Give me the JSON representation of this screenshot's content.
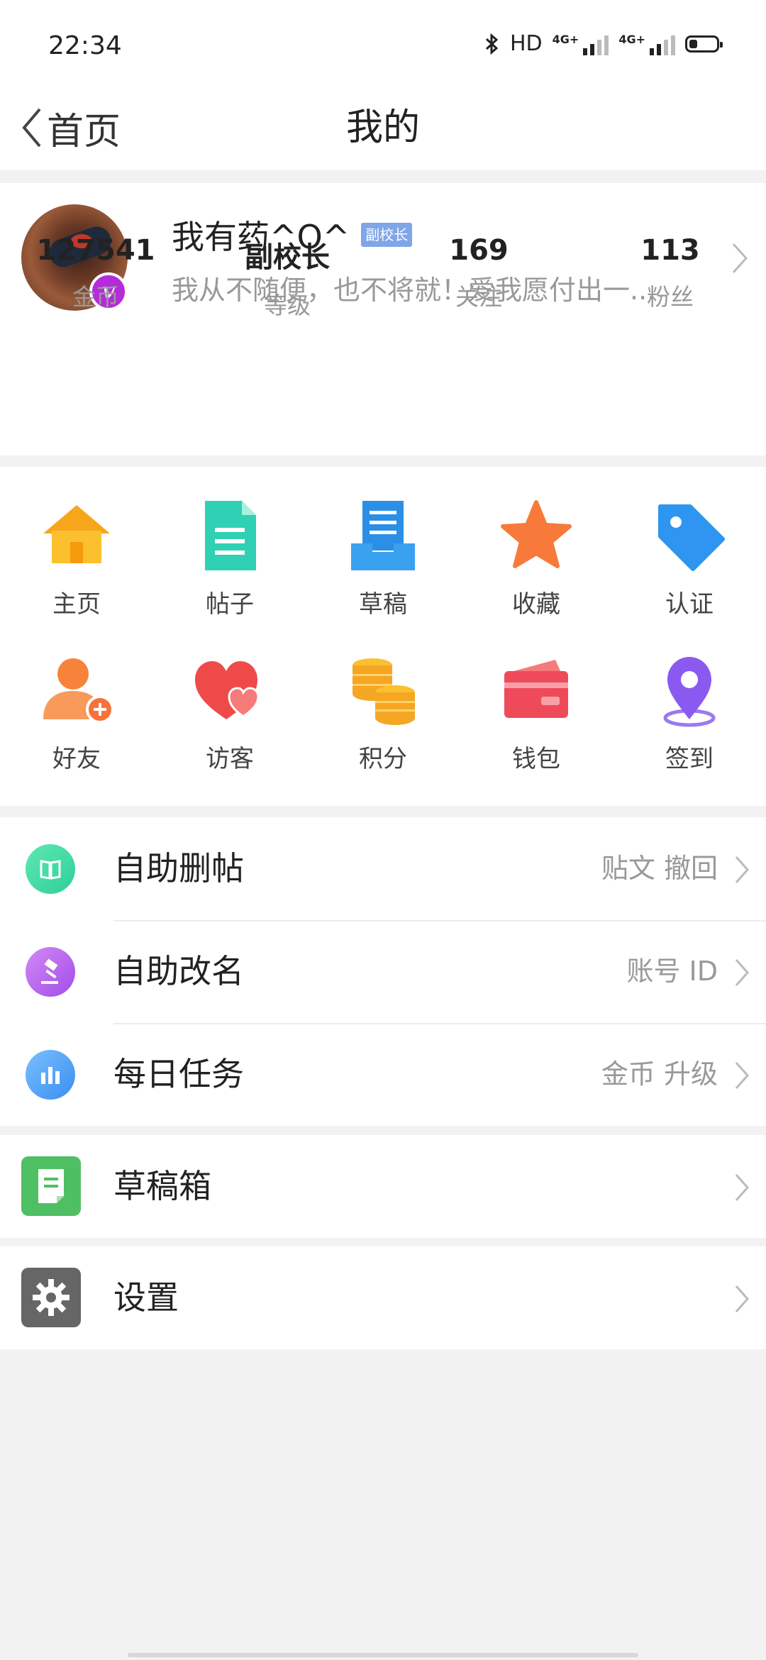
{
  "status_bar": {
    "time": "22:34",
    "hd": "HD",
    "net1": "4G+",
    "net2": "4G+",
    "battery_level": 0.3
  },
  "nav": {
    "back_label": "首页",
    "title": "我的"
  },
  "profile": {
    "nickname": "我有药^O^",
    "role_badge": "副校长",
    "signature": "我从不随便，也不将就！爱我愿付出一...",
    "verified_badge": "v",
    "stats": [
      {
        "value": "127541",
        "label": "金币"
      },
      {
        "value": "副校长",
        "label": "等级"
      },
      {
        "value": "169",
        "label": "关注"
      },
      {
        "value": "113",
        "label": "粉丝"
      }
    ]
  },
  "grid": {
    "items": [
      {
        "label": "主页",
        "icon": "home-icon"
      },
      {
        "label": "帖子",
        "icon": "document-icon"
      },
      {
        "label": "草稿",
        "icon": "draft-tray-icon"
      },
      {
        "label": "收藏",
        "icon": "star-icon"
      },
      {
        "label": "认证",
        "icon": "tag-icon"
      },
      {
        "label": "好友",
        "icon": "add-friend-icon"
      },
      {
        "label": "访客",
        "icon": "hearts-icon"
      },
      {
        "label": "积分",
        "icon": "coins-icon"
      },
      {
        "label": "钱包",
        "icon": "wallet-icon"
      },
      {
        "label": "签到",
        "icon": "location-pin-icon"
      }
    ]
  },
  "list1": {
    "items": [
      {
        "title": "自助删帖",
        "sub": "贴文  撤回",
        "icon": "book-icon"
      },
      {
        "title": "自助改名",
        "sub": "账号  ID",
        "icon": "gavel-icon"
      },
      {
        "title": "每日任务",
        "sub": "金币  升级",
        "icon": "bar-chart-icon"
      }
    ]
  },
  "list2": {
    "title": "草稿箱",
    "icon": "draft-box-icon"
  },
  "list3": {
    "title": "设置",
    "icon": "settings-gear-icon"
  }
}
